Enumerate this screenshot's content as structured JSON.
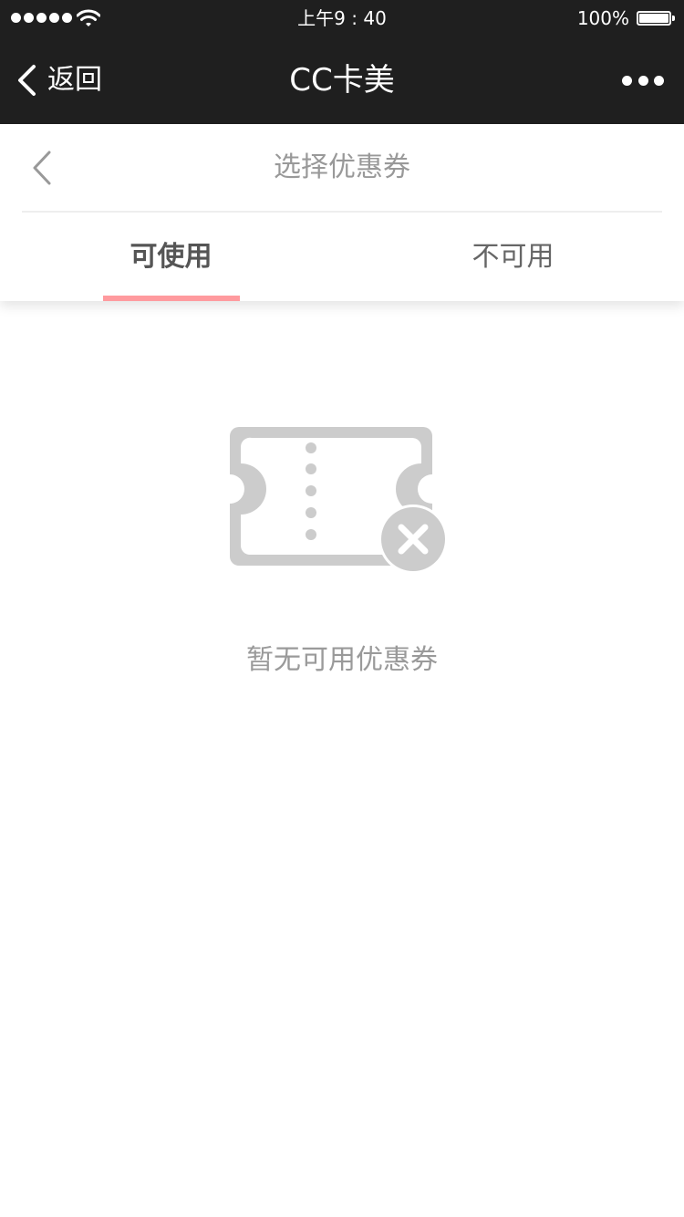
{
  "status_bar": {
    "time": "上午9 : 40",
    "battery": "100%"
  },
  "nav": {
    "back_label": "返回",
    "title": "CC卡美"
  },
  "page": {
    "title": "选择优惠券"
  },
  "tabs": [
    {
      "label": "可使用",
      "active": true
    },
    {
      "label": "不可用",
      "active": false
    }
  ],
  "empty_state": {
    "message": "暂无可用优惠券"
  },
  "colors": {
    "nav_background": "#1f1f1f",
    "active_tab_underline": "#ff9a9e",
    "empty_icon": "#cccccc"
  },
  "icons": {
    "nav_back": "chevron-left-icon",
    "nav_more": "more-dots-icon",
    "page_back": "chevron-left-icon",
    "empty": "coupon-unavailable-icon"
  }
}
